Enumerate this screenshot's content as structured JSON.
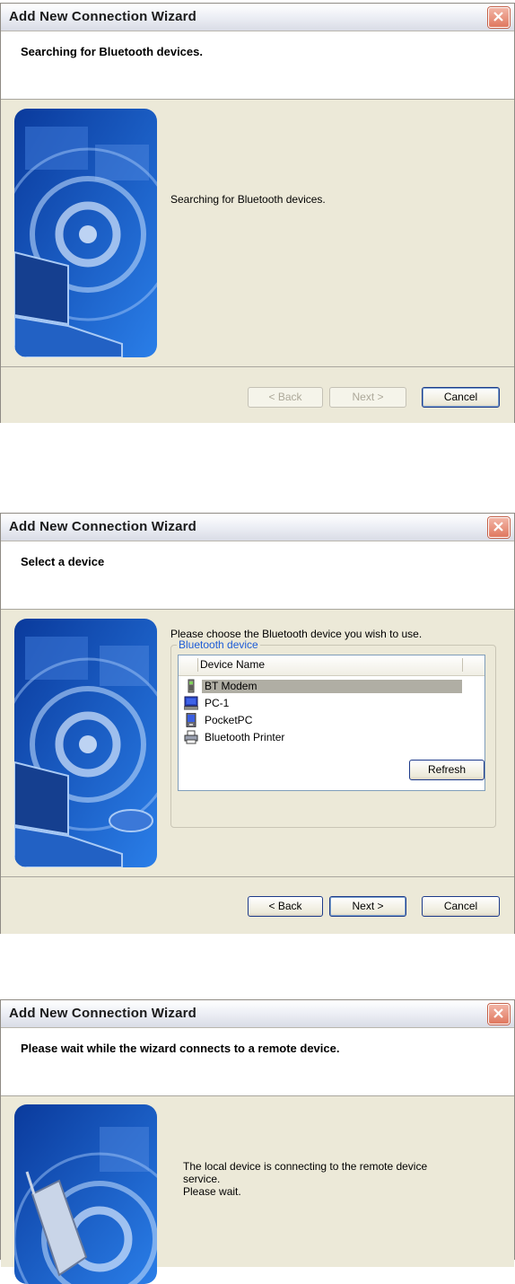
{
  "dialog1": {
    "title": "Add New Connection Wizard",
    "header": "Searching for Bluetooth devices.",
    "message": "Searching for Bluetooth devices.",
    "buttons": {
      "back": "< Back",
      "next": "Next >",
      "cancel": "Cancel"
    }
  },
  "dialog2": {
    "title": "Add New Connection Wizard",
    "header": "Select a device",
    "instruction": "Please choose the Bluetooth device you wish to use.",
    "group_label": "Bluetooth device",
    "column_header": "Device Name",
    "devices": [
      {
        "label": "BT Modem",
        "icon": "modem-icon",
        "selected": true
      },
      {
        "label": "PC-1",
        "icon": "computer-icon",
        "selected": false
      },
      {
        "label": "PocketPC",
        "icon": "pda-icon",
        "selected": false
      },
      {
        "label": "Bluetooth Printer",
        "icon": "printer-icon",
        "selected": false
      }
    ],
    "refresh_label": "Refresh",
    "buttons": {
      "back": "< Back",
      "next": "Next >",
      "cancel": "Cancel"
    }
  },
  "dialog3": {
    "title": "Add New Connection Wizard",
    "header": "Please wait while the wizard connects to a remote device.",
    "message_line1": "The local device is connecting to the remote device",
    "message_line2": "service.",
    "message_line3": "Please wait."
  },
  "colors": {
    "accent": "#1d5bd6",
    "face": "#ece9d8",
    "close": "#e0785f"
  }
}
